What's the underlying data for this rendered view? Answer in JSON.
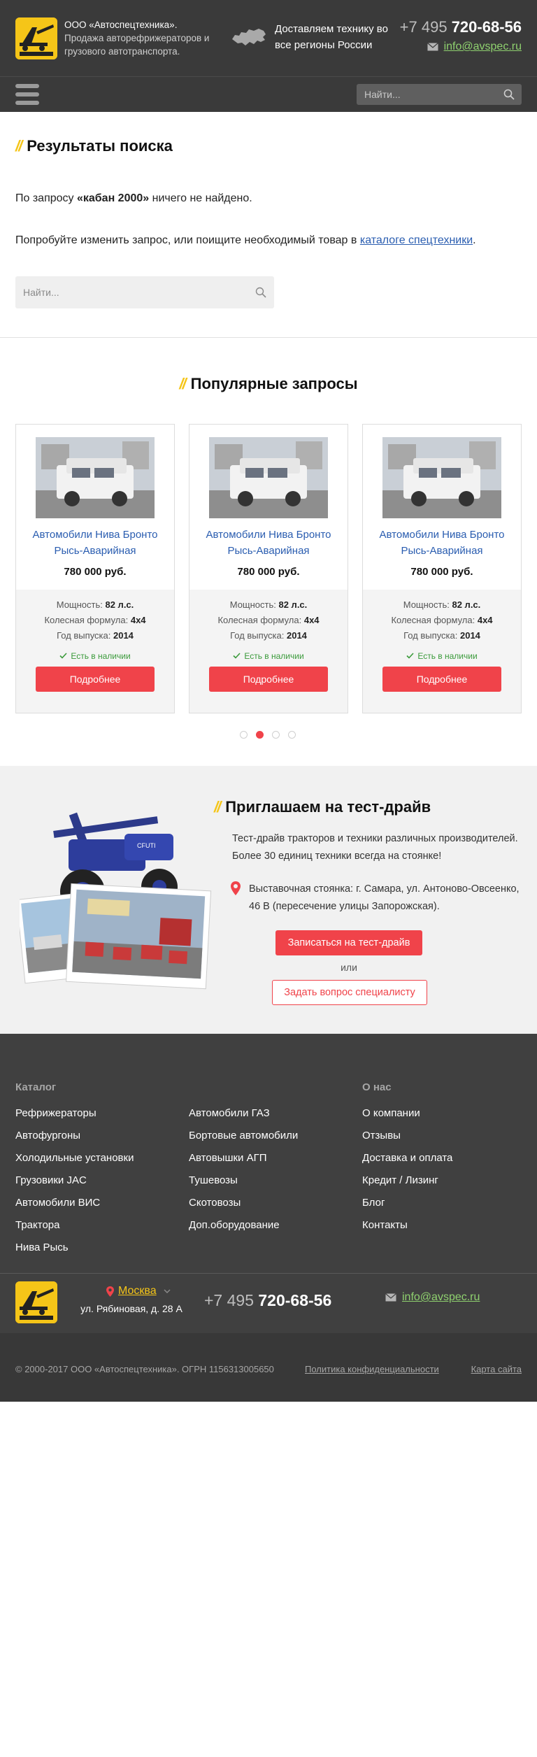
{
  "header": {
    "company_name": "ООО «Автоспецтехника».",
    "company_desc": "Продажа авторефрижераторов и грузового автотранспорта.",
    "delivery": "Доставляем технику во все регионы России",
    "phone_code": "+7 495",
    "phone_number": "720-68-56",
    "email": "info@avspec.ru",
    "logo_icon": "logo-icon",
    "brand_color": "#f5c518"
  },
  "nav": {
    "menu_icon": "burger-menu-icon",
    "search_placeholder": "Найти..."
  },
  "results": {
    "title": "Результаты поиска",
    "query_prefix": "По запросу ",
    "query": "«кабан 2000»",
    "query_suffix": " ничего не найдено.",
    "suggest_prefix": "Попробуйте изменить запрос, или поищите необходимый товар в ",
    "suggest_link": "каталоге спецтехники",
    "suggest_suffix": ".",
    "search_placeholder": "Найти..."
  },
  "popular": {
    "title": "Популярные запросы",
    "cards": [
      {
        "title": "Автомобили Нива Бронто Рысь-Аварийная",
        "price": "780 000 руб.",
        "power_label": "Мощность: ",
        "power_value": "82 л.с.",
        "wheels_label": "Колесная формула: ",
        "wheels_value": "4х4",
        "year_label": "Год выпуска: ",
        "year_value": "2014",
        "stock": "Есть в наличии",
        "button": "Подробнее"
      },
      {
        "title": "Автомобили Нива Бронто Рысь-Аварийная",
        "price": "780 000 руб.",
        "power_label": "Мощность: ",
        "power_value": "82 л.с.",
        "wheels_label": "Колесная формула: ",
        "wheels_value": "4х4",
        "year_label": "Год выпуска: ",
        "year_value": "2014",
        "stock": "Есть в наличии",
        "button": "Подробнее"
      },
      {
        "title": "Автомобили Нива Бронто Рысь-Аварийная",
        "price": "780 000 руб.",
        "power_label": "Мощность: ",
        "power_value": "82 л.с.",
        "wheels_label": "Колесная формула: ",
        "wheels_value": "4х4",
        "year_label": "Год выпуска: ",
        "year_value": "2014",
        "stock": "Есть в наличии",
        "button": "Подробнее"
      }
    ],
    "slider_pages": 4,
    "slider_active": 2,
    "accent_color": "#f0434a"
  },
  "testdrive": {
    "title": "Приглашаем на тест-драйв",
    "text": "Тест-драйв тракторов и техники различных производителей. Более 30 единиц техники всегда на стоянке!",
    "address": "Выставочная стоянка: г. Самара, ул. Антоново-Овсеенко, 46 В (пересечение улицы Запорожская).",
    "primary_button": "Записаться на тест-драйв",
    "or": "или",
    "secondary_button": "Задать вопрос специалисту"
  },
  "footer": {
    "catalog_title": "Каталог",
    "catalog_col1": [
      "Рефрижераторы",
      "Автофургоны",
      "Холодильные установки",
      "Грузовики JAC",
      "Автомобили ВИС",
      "Трактора",
      "Нива Рысь"
    ],
    "catalog_col2": [
      "Автомобили ГАЗ",
      "Бортовые автомобили",
      "Автовышки АГП",
      "Тушевозы",
      "Скотовозы",
      "Доп.оборудование"
    ],
    "about_title": "О нас",
    "about_links": [
      "О компании",
      "Отзывы",
      "Доставка и оплата",
      "Кредит / Лизинг",
      "Блог",
      "Контакты"
    ],
    "city": "Москва",
    "street": "ул. Рябиновая, д. 28 А",
    "phone_code": "+7 495",
    "phone_number": "720-68-56",
    "email": "info@avspec.ru",
    "copyright": "© 2000-2017 ООО «Автоспецтехника». ОГРН 1156313005650",
    "privacy": "Политика конфиденциальности",
    "sitemap": "Карта сайта"
  }
}
